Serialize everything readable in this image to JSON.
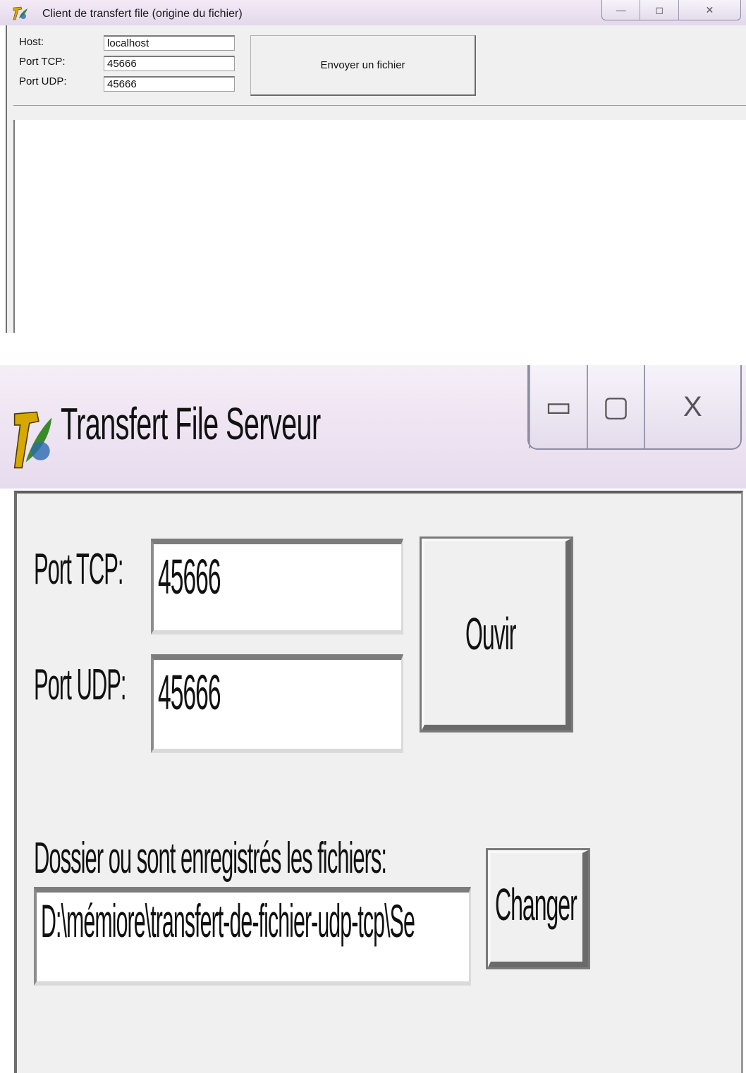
{
  "client": {
    "title": "Client de transfert file (origine du fichier)",
    "caption": {
      "minimize": "—",
      "maximize": "◻",
      "close": "✕"
    },
    "labels": {
      "host": "Host:",
      "tcp": "Port TCP:",
      "udp": "Port UDP:"
    },
    "fields": {
      "host": "localhost",
      "tcp": "45666",
      "udp": "45666"
    },
    "send_button": "Envoyer un fichier",
    "icons": {
      "app": "app-logo-icon"
    }
  },
  "server": {
    "title": "Transfert File Serveur",
    "caption": {
      "minimize": "▭",
      "maximize": "▢",
      "close": "X"
    },
    "labels": {
      "tcp": "Port TCP:",
      "udp": "Port UDP:",
      "folder": "Dossier ou sont enregistrés les fichiers:"
    },
    "fields": {
      "tcp": "45666",
      "udp": "45666",
      "folder": "D:\\mémiore\\transfert-de-fichier-udp-tcp\\Se"
    },
    "buttons": {
      "open": "Ouvir",
      "change": "Changer"
    },
    "icons": {
      "app": "app-logo-icon"
    }
  },
  "colors": {
    "window_bg": "#f0f0f0",
    "titlebar": "#eee4f2",
    "field_bg": "#ffffff"
  }
}
